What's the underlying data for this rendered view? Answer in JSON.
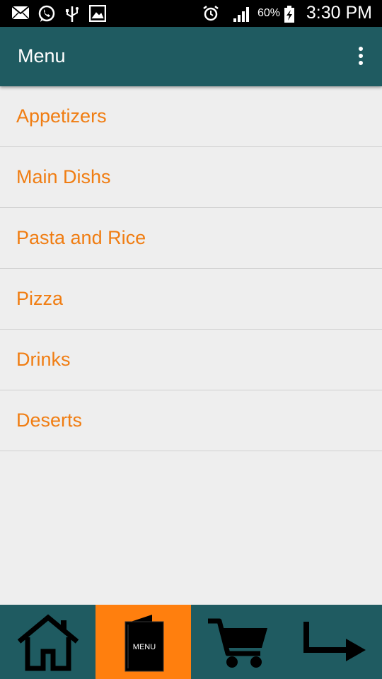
{
  "status_bar": {
    "battery": "60%",
    "time": "3:30 PM"
  },
  "app_bar": {
    "title": "Menu",
    "overflow_icon": "more-vert-icon"
  },
  "menu": {
    "items": [
      {
        "label": "Appetizers"
      },
      {
        "label": "Main Dishs"
      },
      {
        "label": "Pasta and Rice"
      },
      {
        "label": "Pizza"
      },
      {
        "label": "Drinks"
      },
      {
        "label": "Deserts"
      }
    ]
  },
  "bottom_nav": {
    "menu_icon_text": "MENU",
    "active_tab": "menu",
    "items": [
      "home-icon",
      "menu-book-icon",
      "cart-icon",
      "arrow-forward-icon"
    ]
  },
  "colors": {
    "primary": "#1f5b61",
    "accent": "#ff7f0e",
    "item_text": "#f07d12",
    "background": "#eeeeee"
  }
}
